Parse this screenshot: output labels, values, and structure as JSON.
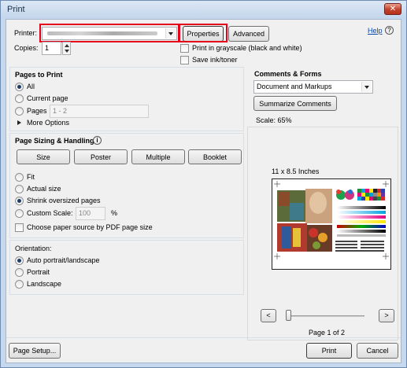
{
  "window": {
    "title": "Print"
  },
  "header": {
    "help_label": "Help",
    "help_icon": "help-circle-icon",
    "printer_label": "Printer:",
    "printer_value": "",
    "properties_label": "Properties",
    "advanced_label": "Advanced",
    "copies_label": "Copies:",
    "copies_value": "1",
    "grayscale_label": "Print in grayscale (black and white)",
    "save_ink_label": "Save ink/toner"
  },
  "pages_to_print": {
    "heading": "Pages to Print",
    "all_label": "All",
    "current_page_label": "Current page",
    "pages_label": "Pages",
    "pages_value": "1 - 2",
    "more_options_label": "More Options",
    "selected": "All"
  },
  "sizing": {
    "heading": "Page Sizing & Handling",
    "info_icon": "info-icon",
    "tabs": [
      "Size",
      "Poster",
      "Multiple",
      "Booklet"
    ],
    "fit_label": "Fit",
    "actual_size_label": "Actual size",
    "shrink_label": "Shrink oversized pages",
    "custom_scale_label": "Custom Scale:",
    "custom_scale_value": "100",
    "percent_sign": "%",
    "paper_source_label": "Choose paper source by PDF page size",
    "selected": "Shrink oversized pages"
  },
  "orientation": {
    "heading": "Orientation:",
    "auto_label": "Auto portrait/landscape",
    "portrait_label": "Portrait",
    "landscape_label": "Landscape",
    "selected": "Auto portrait/landscape"
  },
  "comments": {
    "heading": "Comments & Forms",
    "selected_option": "Document and Markups",
    "summarize_label": "Summarize Comments",
    "scale_text": "Scale:  65%"
  },
  "preview": {
    "paper_size": "11 x 8.5 Inches",
    "prev_label": "<",
    "next_label": ">",
    "page_indicator": "Page 1 of 2",
    "slider_fraction": 0.0
  },
  "footer": {
    "page_setup_label": "Page Setup...",
    "print_label": "Print",
    "cancel_label": "Cancel"
  },
  "colors": {
    "highlight": "#e5001a",
    "accent": "#1f3c64"
  }
}
